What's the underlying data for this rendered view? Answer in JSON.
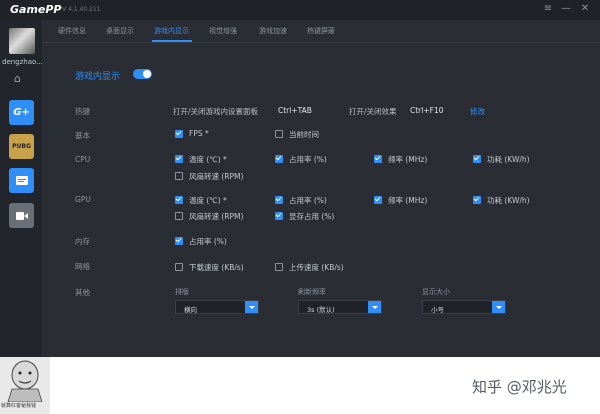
{
  "app": {
    "logo": "GamePP",
    "version": "V 4.1.40.211"
  },
  "window_controls": {
    "settings_icon": "≡",
    "minimize": "—",
    "close": "✕"
  },
  "sidebar": {
    "username": "dengzhao..."
  },
  "tabs": [
    {
      "label": "硬件信息",
      "active": false
    },
    {
      "label": "桌面显示",
      "active": false
    },
    {
      "label": "游戏内显示",
      "active": true
    },
    {
      "label": "视觉增强",
      "active": false
    },
    {
      "label": "游戏加速",
      "active": false
    },
    {
      "label": "热键屏蔽",
      "active": false
    }
  ],
  "header": {
    "title": "游戏内显示",
    "toggle_on": true
  },
  "hotkey": {
    "label": "热键",
    "panel_label": "打开/关闭游戏内设置面板",
    "panel_key": "Ctrl+TAB",
    "effect_label": "打开/关闭效果",
    "effect_key": "Ctrl+F10",
    "edit_link": "修改"
  },
  "basic": {
    "label": "基本",
    "fps": "FPS *",
    "current_time": "当前时间"
  },
  "cpu": {
    "label": "CPU",
    "temp": "温度 (℃) *",
    "usage": "占用率 (%)",
    "freq": "频率 (MHz)",
    "power": "功耗 (KW/h)",
    "fan": "风扇转速 (RPM)"
  },
  "gpu": {
    "label": "GPU",
    "temp": "温度 (℃) *",
    "usage": "占用率 (%)",
    "freq": "频率 (MHz)",
    "power": "功耗 (KW/h)",
    "fan": "风扇转速 (RPM)",
    "vram": "显存占用 (%)"
  },
  "memory": {
    "label": "内存",
    "usage": "占用率 (%)"
  },
  "network": {
    "label": "网络",
    "download": "下载速度 (KB/s)",
    "upload": "上传速度 (KB/s)"
  },
  "other": {
    "label": "其他",
    "layout_label": "排版",
    "layout_value": "横向",
    "refresh_label": "刷新频率",
    "refresh_value": "3s (默认)",
    "size_label": "显示大小",
    "size_value": "小号"
  },
  "footer": {
    "sticker_text": "就算红客秘我钱",
    "watermark": "知乎 @邓兆光"
  },
  "colors": {
    "accent": "#2f8ff7",
    "bg": "#2a2d34"
  }
}
